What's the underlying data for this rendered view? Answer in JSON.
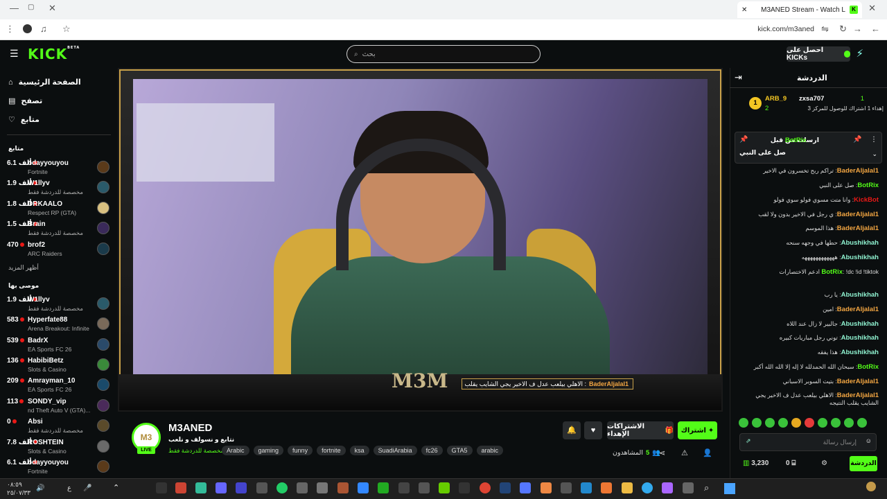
{
  "browser": {
    "tab_title": "M3ANED Stream - Watch L",
    "url": "kick.com/m3aned"
  },
  "header": {
    "logo": "KICK",
    "logo_badge": "BETA",
    "search_placeholder": "بحث",
    "kicks_button": "احصل على KICKs"
  },
  "sidebar": {
    "nav": [
      {
        "label": "الصفحة الرئيسية",
        "icon": "home-icon"
      },
      {
        "label": "تصفح",
        "icon": "browse-icon"
      },
      {
        "label": "متابع",
        "icon": "heart-icon"
      }
    ],
    "following_heading": "متابع",
    "following": [
      {
        "name": "odayyouyou",
        "category": "Fortnite",
        "viewers": "6.1 ألف"
      },
      {
        "name": "W1llyv",
        "category": "مخصصة للدردشة فقط",
        "viewers": "1.9 ألف"
      },
      {
        "name": "DRKAALO",
        "category": "Respect RP (GTA)",
        "viewers": "1.8 ألف"
      },
      {
        "name": "Brain",
        "category": "مخصصة للدردشة فقط",
        "viewers": "1.5 ألف"
      },
      {
        "name": "brof2",
        "category": "ARC Raiders",
        "viewers": "470"
      }
    ],
    "show_more": "أظهر المزيد",
    "recommended_heading": "موصى بها",
    "recommended": [
      {
        "name": "W1llyv",
        "category": "مخصصة للدردشة فقط",
        "viewers": "1.9 ألف"
      },
      {
        "name": "Hyperfate88",
        "category": "Arena Breakout: Infinite",
        "viewers": "583"
      },
      {
        "name": "BadrX",
        "category": "EA Sports FC 26",
        "viewers": "539"
      },
      {
        "name": "HabibiBetz",
        "category": "Slots & Casino",
        "viewers": "136"
      },
      {
        "name": "Amrayman_10",
        "category": "EA Sports FC 26",
        "viewers": "209"
      },
      {
        "name": "SONDY_vip",
        "category": "nd Theft Auto V (GTA)...",
        "viewers": "113"
      },
      {
        "name": "Absi",
        "category": "مخصصة للدردشة فقط",
        "viewers": "0"
      },
      {
        "name": "ROSHTEIN",
        "category": "Slots & Casino",
        "viewers": "7.8 ألف"
      },
      {
        "name": "odayyouyou",
        "category": "Fortnite",
        "viewers": "6.1 ألف"
      }
    ]
  },
  "video": {
    "alert_user": "BaderAljalal1",
    "alert_text": "الاهلي بيلعب عدل ف الاخير يجي الشايب يقلب النتيجه :",
    "overlay_logo": "M3M"
  },
  "stream_info": {
    "avatar_text": "M3",
    "live": "LIVE",
    "name": "M3ANED",
    "title": "نتابع و نسولف و نلعب",
    "category": "مخصصة للدردشة فقط",
    "tags": [
      "Arabic",
      "gaming",
      "funny",
      "fortnite",
      "ksa",
      "SuadiArabia",
      "fc26",
      "GTA5",
      "arabic"
    ],
    "subscribe_label": "اشتراك",
    "gift_label": "الاشتراكات الإهداء",
    "viewers_label": "المشاهدون",
    "viewers_count": "5"
  },
  "chat": {
    "title": "الدردشة",
    "leaderboard": {
      "first_user": "ARB_9",
      "first_count": "2",
      "second_user": "zxsa707",
      "second_count": "1",
      "progress_text": "إهداء 1 اشتراك للوصول للمركز 3"
    },
    "pinned": {
      "header": "ارسلت من قبل",
      "bot": "BotRix",
      "text": "صل على النبي"
    },
    "messages": [
      {
        "user": "BaderAljalal1",
        "color": "orange",
        "text": "تراكم ربح تخسرون في الاخير"
      },
      {
        "user": "BotRix",
        "color": "green",
        "text": "صل على النبي"
      },
      {
        "user": "KickBot",
        "color": "red",
        "text": "وانا متت مسوي فولو سوي فولو"
      },
      {
        "user": "BaderAljalal1",
        "color": "orange",
        "text": "ي رجل في الاخير بدون ولا لقب"
      },
      {
        "user": "BaderAljalal1",
        "color": "orange",
        "text": "هذا الموسم"
      },
      {
        "user": "Abushikhah",
        "color": "teal",
        "text": "حطها في وجهه سنحه"
      },
      {
        "user": "Abushikhah",
        "color": "teal",
        "text": "ههههههههههههه"
      },
      {
        "user": "BotRix",
        "color": "green",
        "text": "!dc !id !tiktok ادعم الاختصارات"
      },
      {
        "user": "Abushikhah",
        "color": "teal",
        "text": "يا رب"
      },
      {
        "user": "BaderAljalal1",
        "color": "orange",
        "text": "امين"
      },
      {
        "user": "Abushikhah",
        "color": "teal",
        "text": "جالبير لا زال عند اللاه"
      },
      {
        "user": "Abushikhah",
        "color": "teal",
        "text": "توني رجل مباريات كبيره"
      },
      {
        "user": "Abushikhah",
        "color": "teal",
        "text": "هذا يفقه"
      },
      {
        "user": "BotRix",
        "color": "green",
        "text": "سبحان الله الحمدلله لا إله إلا الله الله أكبر"
      },
      {
        "user": "BaderAljalal1",
        "color": "orange",
        "text": "بتيت السوبر الاسباني"
      },
      {
        "user": "BaderAljalal1",
        "color": "orange",
        "text": "الاهلي بيلعب عدل ف الاخير يجي الشايب يقلب النتيجه"
      }
    ],
    "input_placeholder": "إرسال رسالة",
    "points": "3,230",
    "gifts": "0",
    "send_label": "الدردشة"
  },
  "taskbar": {
    "time": "٠٨:٥٩",
    "date": "٢٥/٠٧/٣٣",
    "lang": "ع"
  }
}
